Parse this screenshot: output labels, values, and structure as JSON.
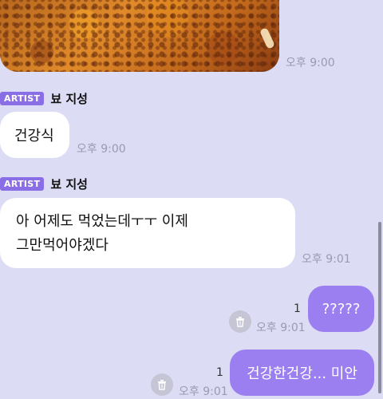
{
  "messages": {
    "photo": {
      "time": "오후 9:00"
    },
    "m1": {
      "badge": "ARTIST",
      "sender": "뵤 지성",
      "text": "건강식",
      "time": "오후 9:00"
    },
    "m2": {
      "badge": "ARTIST",
      "sender": "뵤 지성",
      "line1": "아 어제도 먹었는데ㅜㅜ 이제",
      "line2": "그만먹어야겠다",
      "time": "오후 9:01"
    },
    "m3": {
      "text": "?????",
      "time": "오후 9:01",
      "unread": "1"
    },
    "m4": {
      "text": "건강한건강... 미안",
      "time": "오후 9:01",
      "unread": "1"
    }
  },
  "colors": {
    "background": "#dcdcf4",
    "outgoing_bubble": "#9b7ff0",
    "artist_badge": "#8a6ee6"
  },
  "icons": {
    "delete": "trash-icon"
  }
}
